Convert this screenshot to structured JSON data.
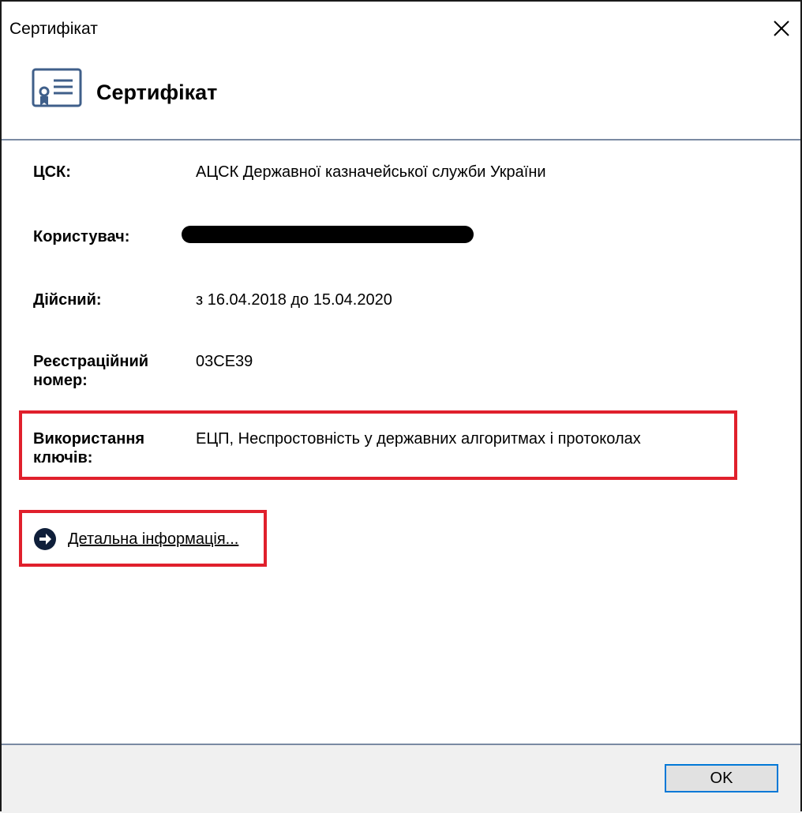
{
  "window": {
    "title": "Сертифікат"
  },
  "header": {
    "title": "Сертифікат",
    "icon": "certificate-icon"
  },
  "fields": {
    "csk": {
      "label": "ЦСК:",
      "value": "АЦСК Державної казначейської служби України"
    },
    "user": {
      "label": "Користувач:",
      "value": ""
    },
    "valid": {
      "label": "Дійсний:",
      "value": "з 16.04.2018 до 15.04.2020"
    },
    "reg_label_1": "Реєстраційний",
    "reg_label_2": "номер:",
    "reg_value": "03CE39",
    "usage_label_1": "Використання",
    "usage_label_2": "ключів:",
    "usage_value": "ЕЦП, Неспростовність у державних алгоритмах і протоколах"
  },
  "details_link": {
    "label": "Детальна інформація...",
    "icon": "arrow-right-circle-icon"
  },
  "footer": {
    "ok_label": "OK"
  },
  "colors": {
    "highlight": "#e0202c",
    "separator": "#7a8aa3",
    "ok_border": "#0078d7"
  }
}
